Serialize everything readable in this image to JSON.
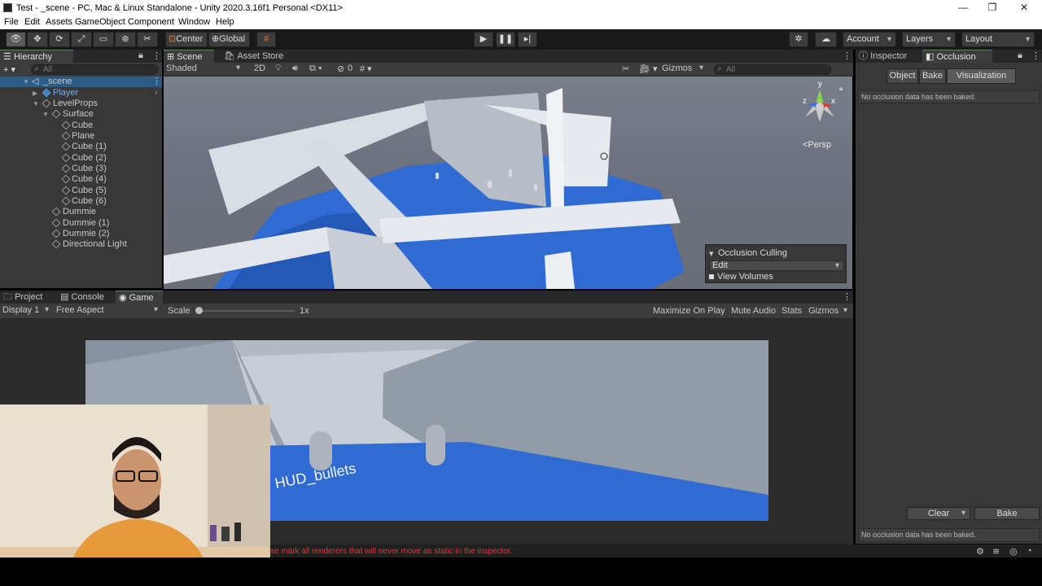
{
  "window": {
    "title": "Test - _scene - PC, Mac & Linux Standalone - Unity 2020.3.16f1 Personal <DX11>",
    "minimize": "—",
    "maximize": "❐",
    "close": "✕"
  },
  "menu": [
    "File",
    "Edit",
    "Assets",
    "GameObject",
    "Component",
    "Window",
    "Help"
  ],
  "toolbar": {
    "pivot": "Center",
    "space": "Global",
    "account": "Account",
    "layers": "Layers",
    "layout": "Layout"
  },
  "hierarchy": {
    "tab": "Hierarchy",
    "search_placeholder": "All",
    "add": "+ ▾",
    "items": [
      {
        "label": "_scene"
      },
      {
        "label": "Player"
      },
      {
        "label": "LevelProps"
      },
      {
        "label": "Surface"
      },
      {
        "label": "Cube"
      },
      {
        "label": "Plane"
      },
      {
        "label": "Cube (1)"
      },
      {
        "label": "Cube (2)"
      },
      {
        "label": "Cube (3)"
      },
      {
        "label": "Cube (4)"
      },
      {
        "label": "Cube (5)"
      },
      {
        "label": "Cube (6)"
      },
      {
        "label": "Dummie"
      },
      {
        "label": "Dummie (1)"
      },
      {
        "label": "Dummie (2)"
      },
      {
        "label": "Directional Light"
      }
    ]
  },
  "scene": {
    "tabs": [
      "Scene",
      "Asset Store"
    ],
    "shading": "Shaded",
    "mode_2d": "2D",
    "fx_count": "0",
    "gizmos": "Gizmos",
    "search_placeholder": "All",
    "persp": "<Persp",
    "gizmo_axes": {
      "x": "x",
      "y": "y",
      "z": "z"
    },
    "overlay": {
      "title": "Occlusion Culling",
      "mode": "Edit",
      "view_volumes": "View Volumes"
    }
  },
  "bottom_tabs": [
    "Project",
    "Console",
    "Game"
  ],
  "game": {
    "display": "Display 1",
    "aspect": "Free Aspect",
    "scale_label": "Scale",
    "scale_value": "1x",
    "scale_level": 0,
    "maximize": "Maximize On Play",
    "mute": "Mute Audio",
    "stats": "Stats",
    "gizmos": "Gizmos",
    "hud_text": "HUD_bullets"
  },
  "inspector": {
    "tabs": [
      "Inspector",
      "Occlusion"
    ],
    "buttons": [
      "Object",
      "Bake",
      "Visualization"
    ],
    "message_top": "No occlusion data has been baked.",
    "clear": "Clear",
    "bake": "Bake",
    "message_bottom": "No occlusion data has been baked."
  },
  "status": {
    "message": "se mark all renderers that will never move as static in the inspector."
  },
  "colors": {
    "accent": "#4d7ad5",
    "floor_blue": "#2f6bd3",
    "wall_white": "#d8dde4",
    "error_red": "#d93a3a"
  }
}
